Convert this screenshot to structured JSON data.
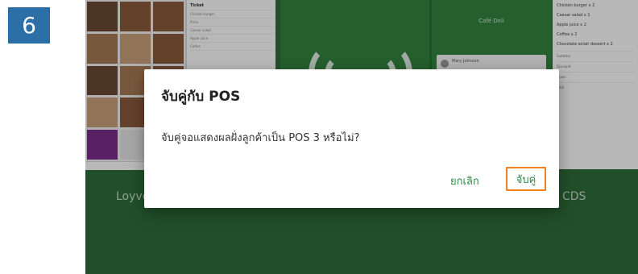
{
  "step_number": "6",
  "background": {
    "pos_ticket": {
      "title": "Ticket",
      "rows": [
        {
          "item": "Chicken burger",
          "price": ""
        },
        {
          "item": "Pizza",
          "price": ""
        },
        {
          "item": "Caesar salad",
          "price": ""
        },
        {
          "item": "Apple juice",
          "price": ""
        },
        {
          "item": "Coffee",
          "price": ""
        }
      ]
    },
    "cds": {
      "store_name": "Café Deli",
      "customer_name": "Mary Johnson",
      "items": [
        {
          "name": "Chicken burger x 2",
          "note": ""
        },
        {
          "name": "Caesar salad x 1",
          "note": ""
        },
        {
          "name": "Apple juice x 2",
          "note": ""
        },
        {
          "name": "Coffee x 2",
          "note": ""
        },
        {
          "name": "Chocolate eclair dessert x 2",
          "note": ""
        }
      ],
      "footer": [
        "Subtotal",
        "Discount",
        "Taxes",
        "Total"
      ]
    },
    "brand_left": "Loyve",
    "brand_right": "CDS"
  },
  "dialog": {
    "title": "จับคู่กับ POS",
    "message": "จับคู่จอแสดงผลฝั่งลูกค้าเป็น POS 3 หรือไม่?",
    "cancel_label": "ยกเลิก",
    "confirm_label": "จับคู่"
  },
  "colors": {
    "accent_green": "#2f8a44",
    "highlight_orange": "#f08020",
    "step_badge_blue": "#2b6fa6"
  }
}
